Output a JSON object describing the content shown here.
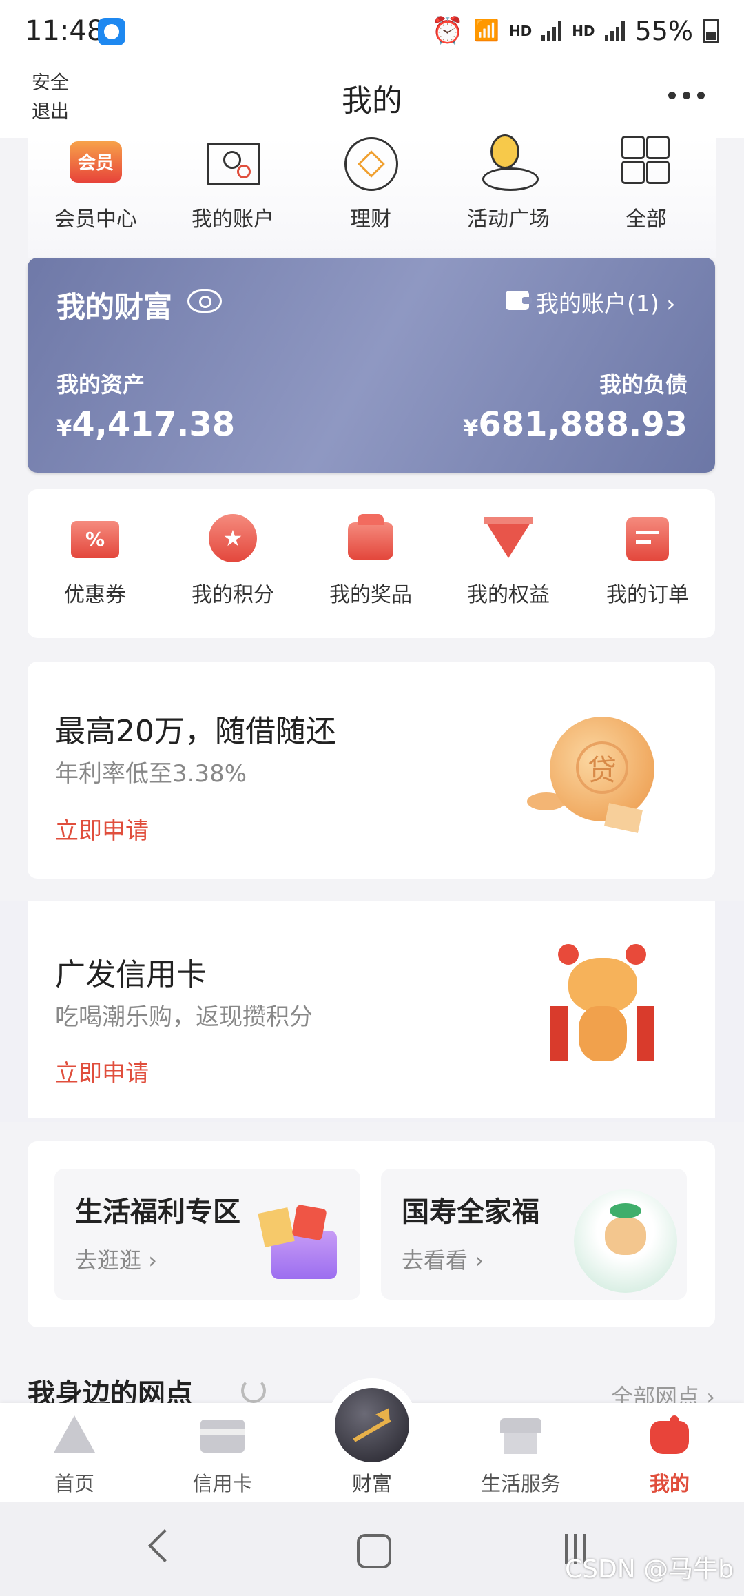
{
  "status_bar": {
    "time": "11:48",
    "hd1": "HD",
    "hd2": "HD",
    "battery": "55%"
  },
  "header": {
    "logout": "安全退出",
    "title": "我的"
  },
  "top_menu": [
    {
      "label": "会员中心",
      "badge": "会员",
      "icon": "vip-icon"
    },
    {
      "label": "我的账户",
      "icon": "account-icon"
    },
    {
      "label": "理财",
      "icon": "finance-icon"
    },
    {
      "label": "活动广场",
      "icon": "activity-icon"
    },
    {
      "label": "全部",
      "icon": "grid-icon"
    }
  ],
  "wealth": {
    "title": "我的财富",
    "account_link": "我的账户(1)",
    "asset_label": "我的资产",
    "asset_currency": "¥",
    "asset_value": "4,417.38",
    "debt_label": "我的负债",
    "debt_currency": "¥",
    "debt_value": "681,888.93"
  },
  "benefits": [
    {
      "label": "优惠券",
      "icon": "coupon-icon"
    },
    {
      "label": "我的积分",
      "icon": "points-icon"
    },
    {
      "label": "我的奖品",
      "icon": "prize-icon"
    },
    {
      "label": "我的权益",
      "icon": "rights-icon"
    },
    {
      "label": "我的订单",
      "icon": "order-icon"
    }
  ],
  "loan": {
    "title": "最高20万，随借随还",
    "subtitle": "年利率低至3.38%",
    "apply": "立即申请",
    "coin_text": "贷"
  },
  "credit": {
    "title": "广发信用卡",
    "subtitle": "吃喝潮乐购，返现攒积分",
    "apply": "立即申请"
  },
  "welfare": [
    {
      "title": "生活福利专区",
      "link": "去逛逛"
    },
    {
      "title": "国寿全家福",
      "link": "去看看"
    }
  ],
  "nearby": {
    "title": "我身边的网点",
    "all": "全部网点"
  },
  "tabs": [
    {
      "label": "首页"
    },
    {
      "label": "信用卡"
    },
    {
      "label": "财富"
    },
    {
      "label": "生活服务"
    },
    {
      "label": "我的",
      "active": true
    }
  ],
  "watermark": "CSDN @马牛b",
  "colors": {
    "accent": "#e04e3c",
    "wealth_card": "#7d87b5"
  }
}
